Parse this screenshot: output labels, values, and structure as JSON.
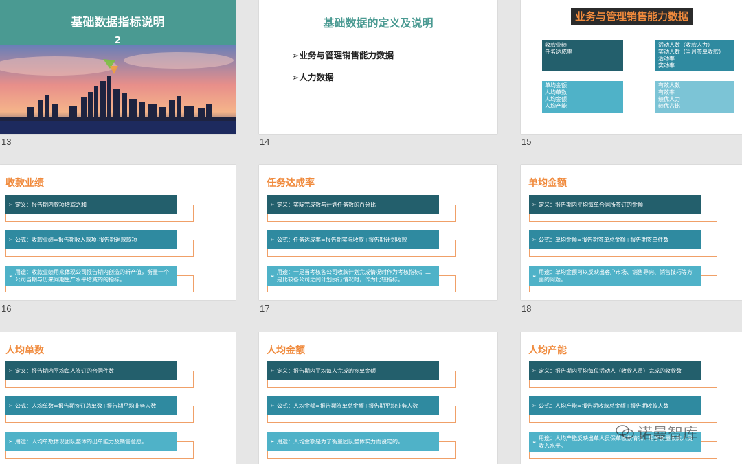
{
  "slides": {
    "s13": {
      "number": "13",
      "title": "基础数据指标说明",
      "subtitle": "2"
    },
    "s14": {
      "number": "14",
      "title": "基础数据的定义及说明",
      "items": [
        "➢业务与管理销售能力数据",
        "➢人力数据"
      ]
    },
    "s15": {
      "number": "15",
      "title": "业务与管理销售能力数据",
      "box_top_left": [
        "收款业绩",
        "任务达成率"
      ],
      "box_top_right": [
        "活动人数（收款人力）",
        "实动人数（当月签单收款）",
        "活动率",
        "实动率"
      ],
      "box_bottom_left": [
        "单均金额",
        "人均单数",
        "人均金额",
        "人均产能"
      ],
      "box_bottom_right": [
        "有效人数",
        "有效率",
        "绩优人力",
        "绩优占比"
      ]
    },
    "s16": {
      "number": "16",
      "title": "收款业绩",
      "definition": "定义：报告期内款项增减之和",
      "formula": "公式：收款业绩=报告期收入款项-报告期退款款项",
      "usage": "用途：收款业绩用来体现公司报告期内创造的新产值，衡量一个公司当期与历来同期生产水平增减的的指标。"
    },
    "s17": {
      "number": "17",
      "title": "任务达成率",
      "definition": "定义：实际完成数与计划任务数的百分比",
      "formula": "公式：任务达成率=报告期实际收款÷报告期计划收款",
      "usage": "用途：一是当考核各公司收款计划完成情况时作为考核指标；二是比较各公司之间计划执行情况时，作为比较指标。"
    },
    "s18": {
      "number": "18",
      "title": "单均金额",
      "definition": "定义：报告期内平均每单合同所签订的金额",
      "formula": "公式：单均金额=报告期签单总金额÷报告期签单件数",
      "usage": "用途：单均金额可以反映出客户市场、销售导向、销售技巧等方面的问题。"
    },
    "s19": {
      "title": "人均单数",
      "definition": "定义：报告期内平均每人签订的合同件数",
      "formula": "公式：人均单数=报告期签订总单数÷报告期平均业务人数",
      "usage": "用途：人均单数体现团队整体的出单能力及销售意愿。"
    },
    "s20": {
      "title": "人均金额",
      "definition": "定义：报告期内平均每人完成的签单金额",
      "formula": "公式：人均金额=报告期签单总金额÷报告期平均业务人数",
      "usage": "用途：人均金额是为了衡量团队整体实力而设定的。"
    },
    "s21": {
      "title": "人均产能",
      "definition": "定义：报告期内平均每位活动人（收款人员）完成的收款数",
      "formula": "公式：人均产能=报告期收款总金额÷报告期收款人数",
      "usage": "用途：人均产能反映出单人员保单收款情况，用于衡量收款人员收入水平。"
    }
  },
  "watermark": "诺曼智库",
  "colors": {
    "accent_teal": "#4a9a92",
    "title_orange": "#f08a3c",
    "definition_bar": "#235f6c",
    "formula_bar": "#2f8aa0",
    "usage_bar": "#4fb2c8"
  }
}
